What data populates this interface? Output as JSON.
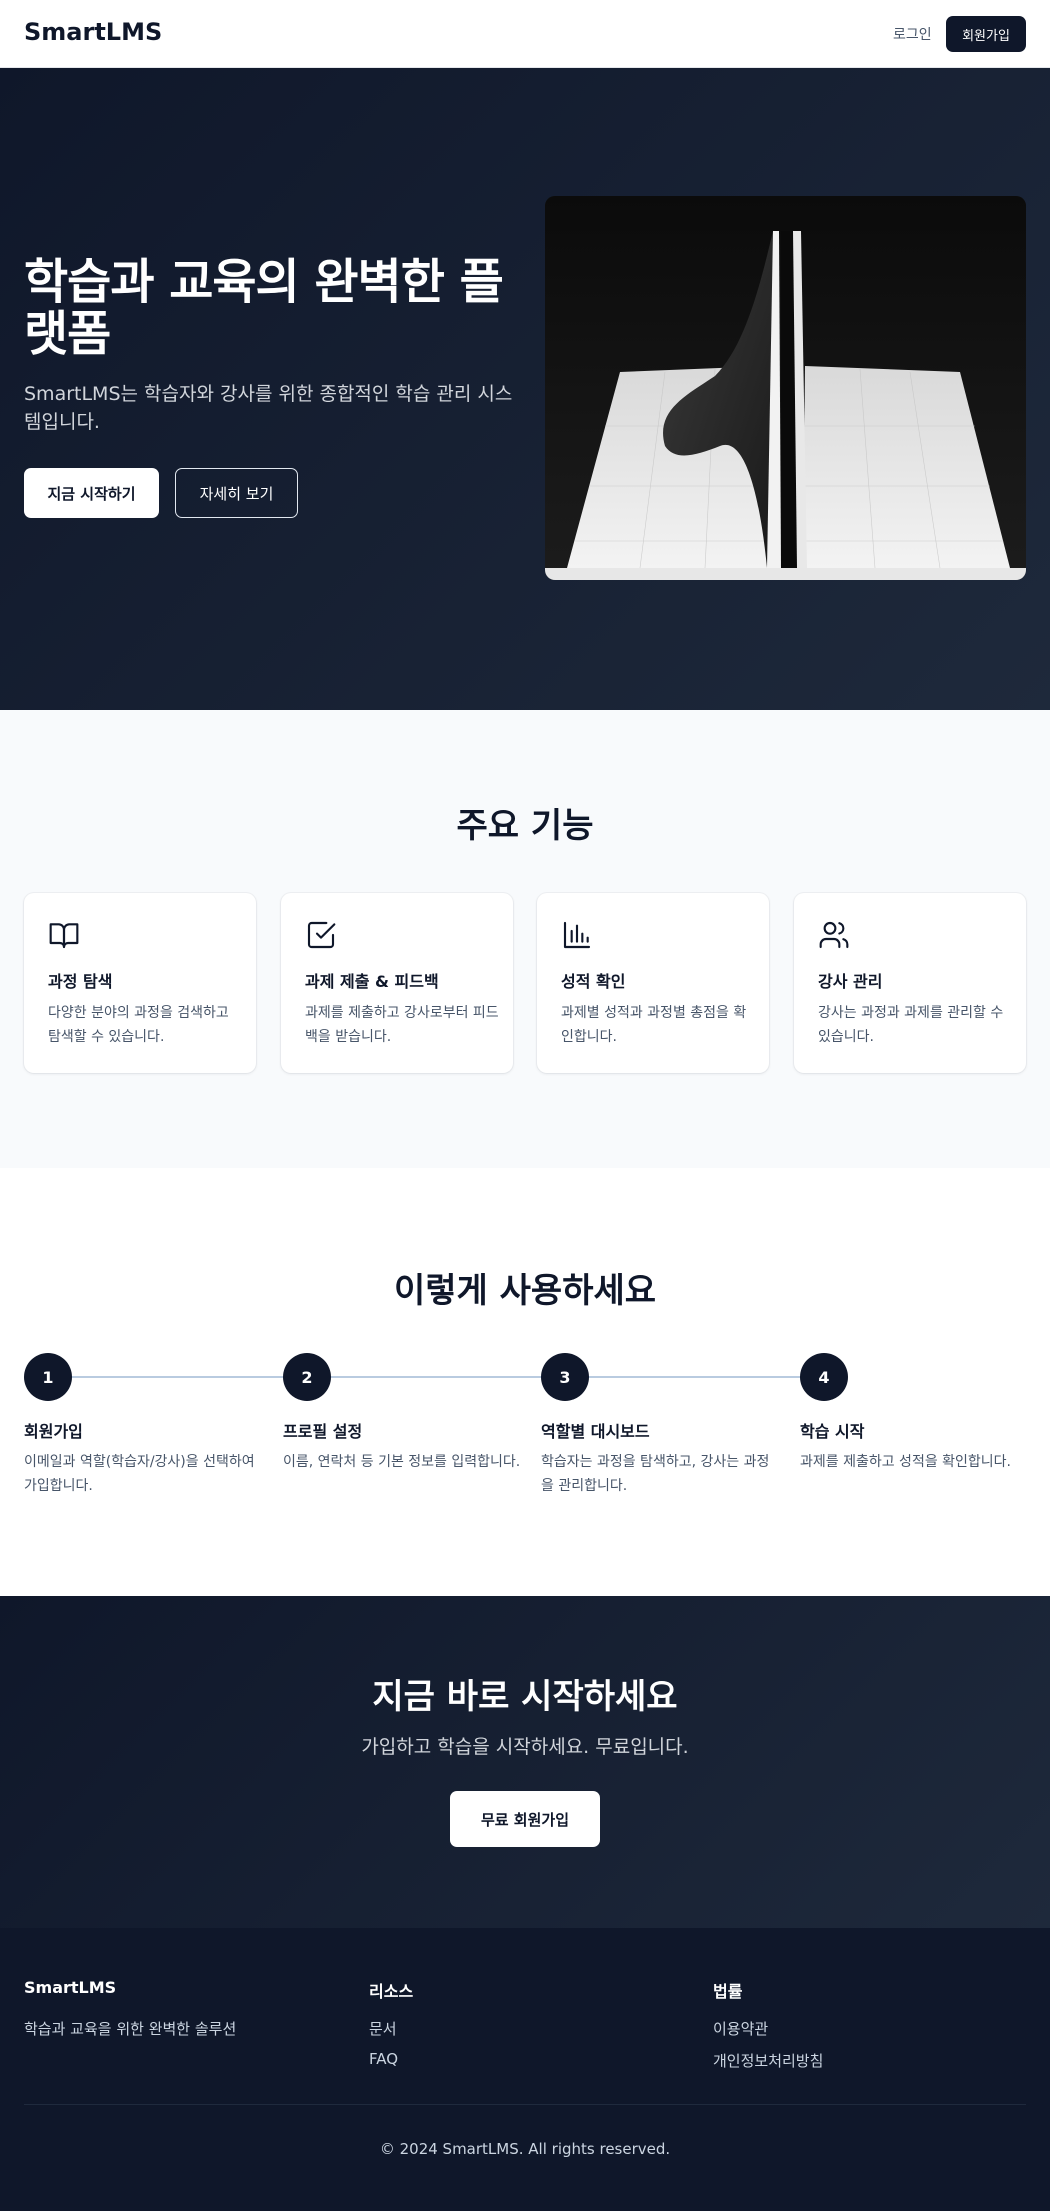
{
  "header": {
    "brand": "SmartLMS",
    "login_label": "로그인",
    "signup_label": "회원가입"
  },
  "hero": {
    "title": "학습과 교육의 완벽한 플랫폼",
    "subtitle": "SmartLMS는 학습자와 강사를 위한 종합적인 학습 관리 시스템입니다.",
    "primary_cta": "지금 시작하기",
    "secondary_cta": "자세히 보기"
  },
  "features": {
    "title": "주요 기능",
    "items": [
      {
        "icon": "book-open-icon",
        "title": "과정 탐색",
        "desc": "다양한 분야의 과정을 검색하고 탐색할 수 있습니다."
      },
      {
        "icon": "check-square-icon",
        "title": "과제 제출 & 피드백",
        "desc": "과제를 제출하고 강사로부터 피드백을 받습니다."
      },
      {
        "icon": "bar-chart-icon",
        "title": "성적 확인",
        "desc": "과제별 성적과 과정별 총점을 확인합니다."
      },
      {
        "icon": "users-icon",
        "title": "강사 관리",
        "desc": "강사는 과정과 과제를 관리할 수 있습니다."
      }
    ]
  },
  "steps": {
    "title": "이렇게 사용하세요",
    "items": [
      {
        "number": "1",
        "title": "회원가입",
        "desc": "이메일과 역할(학습자/강사)을 선택하여 가입합니다."
      },
      {
        "number": "2",
        "title": "프로필 설정",
        "desc": "이름, 연락처 등 기본 정보를 입력합니다."
      },
      {
        "number": "3",
        "title": "역할별 대시보드",
        "desc": "학습자는 과정을 탐색하고, 강사는 과정을 관리합니다."
      },
      {
        "number": "4",
        "title": "학습 시작",
        "desc": "과제를 제출하고 성적을 확인합니다."
      }
    ]
  },
  "cta": {
    "title": "지금 바로 시작하세요",
    "subtitle": "가입하고 학습을 시작하세요. 무료입니다.",
    "button": "무료 회원가입"
  },
  "footer": {
    "brand": "SmartLMS",
    "tagline": "학습과 교육을 위한 완벽한 솔루션",
    "resources_title": "리소스",
    "resources": [
      "문서",
      "FAQ"
    ],
    "legal_title": "법률",
    "legal": [
      "이용약관",
      "개인정보처리방침"
    ],
    "copyright": "© 2024 SmartLMS. All rights reserved."
  },
  "colors": {
    "navy": "#0f172a",
    "slate": "#1e293b",
    "muted_text": "#475569",
    "step_line": "#b9cbe0",
    "section_bg": "#f8fafc"
  }
}
